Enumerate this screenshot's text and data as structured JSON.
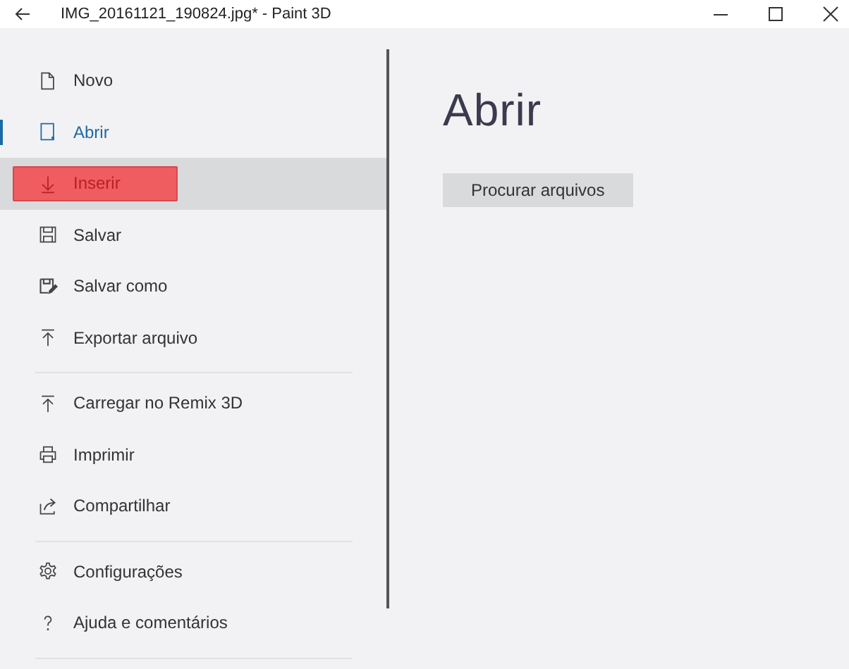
{
  "window": {
    "title": "IMG_20161121_190824.jpg* - Paint 3D"
  },
  "menu": {
    "groups": [
      {
        "items": [
          {
            "label": "Novo",
            "selected": false,
            "hovered": false,
            "highlighted": false
          },
          {
            "label": "Abrir",
            "selected": true,
            "hovered": false,
            "highlighted": false
          },
          {
            "label": "Inserir",
            "selected": false,
            "hovered": true,
            "highlighted": true
          },
          {
            "label": "Salvar",
            "selected": false,
            "hovered": false,
            "highlighted": false
          },
          {
            "label": "Salvar como",
            "selected": false,
            "hovered": false,
            "highlighted": false
          },
          {
            "label": "Exportar arquivo",
            "selected": false,
            "hovered": false,
            "highlighted": false
          }
        ]
      },
      {
        "items": [
          {
            "label": "Carregar no Remix 3D",
            "selected": false,
            "hovered": false,
            "highlighted": false
          },
          {
            "label": "Imprimir",
            "selected": false,
            "hovered": false,
            "highlighted": false
          },
          {
            "label": "Compartilhar",
            "selected": false,
            "hovered": false,
            "highlighted": false
          }
        ]
      },
      {
        "items": [
          {
            "label": "Configurações",
            "selected": false,
            "hovered": false,
            "highlighted": false
          },
          {
            "label": "Ajuda e comentários",
            "selected": false,
            "hovered": false,
            "highlighted": false
          }
        ]
      }
    ]
  },
  "panel": {
    "heading": "Abrir",
    "button": "Procurar arquivos"
  }
}
